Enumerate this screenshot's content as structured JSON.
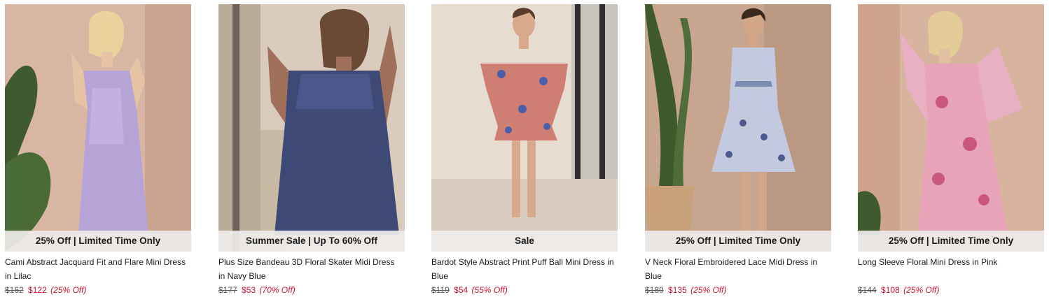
{
  "products": [
    {
      "badge": "25% Off | Limited Time Only",
      "title": "Cami Abstract Jacquard Fit and Flare Mini Dress in Lilac",
      "old_price": "$162",
      "new_price": "$122",
      "discount": "(25% Off)"
    },
    {
      "badge": "Summer Sale | Up To 60% Off",
      "title": "Plus Size Bandeau 3D Floral Skater Midi Dress in Navy Blue",
      "old_price": "$177",
      "new_price": "$53",
      "discount": "(70% Off)"
    },
    {
      "badge": "Sale",
      "title": "Bardot Style Abstract Print Puff Ball Mini Dress in Blue",
      "old_price": "$119",
      "new_price": "$54",
      "discount": "(55% Off)"
    },
    {
      "badge": "25% Off | Limited Time Only",
      "title": "V Neck Floral Embroidered Lace Midi Dress in Blue",
      "old_price": "$180",
      "new_price": "$135",
      "discount": "(25% Off)"
    },
    {
      "badge": "25% Off | Limited Time Only",
      "title": "Long Sleeve Floral Mini Dress in Pink",
      "old_price": "$144",
      "new_price": "$108",
      "discount": "(25% Off)"
    }
  ],
  "colors": {
    "sale_price": "#c8102e",
    "badge_bg": "#eeeceaeb"
  }
}
